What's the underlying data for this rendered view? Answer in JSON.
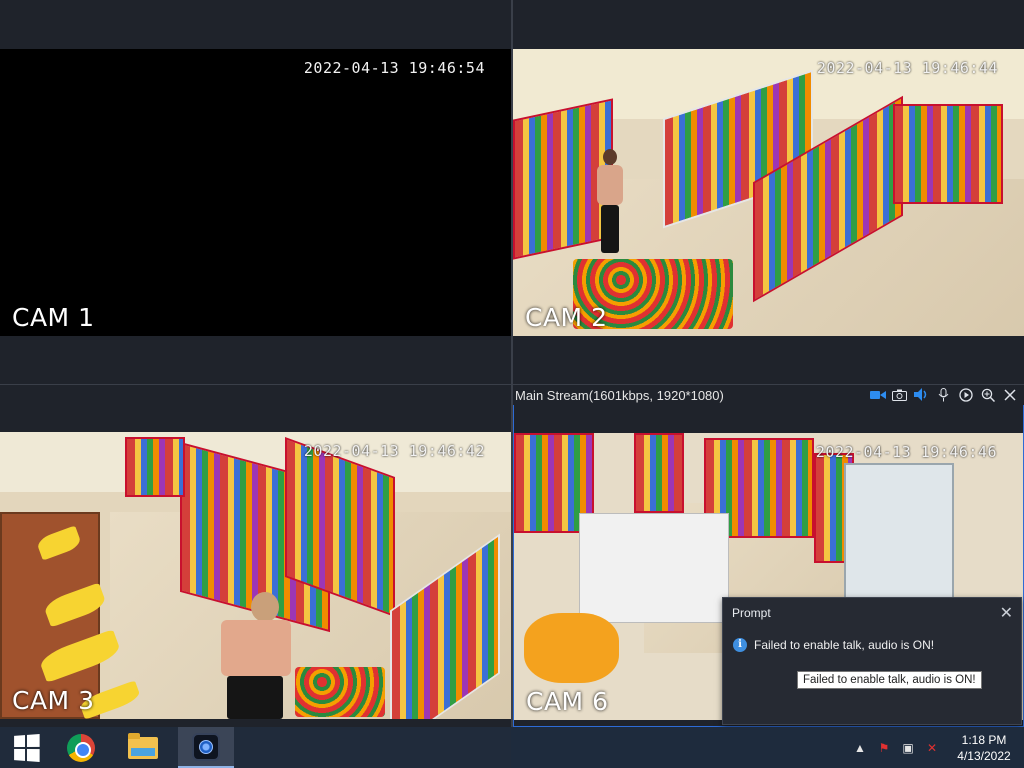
{
  "cameras": [
    {
      "label": "CAM 1",
      "timestamp": "2022-04-13 19:46:54"
    },
    {
      "label": "CAM 2",
      "timestamp": "2022-04-13 19:46:44"
    },
    {
      "label": "CAM 3",
      "timestamp": "2022-04-13 19:46:42"
    },
    {
      "label": "CAM 6",
      "timestamp": "2022-04-13 19:46:46"
    }
  ],
  "stream_bar": {
    "text": "Main Stream(1601kbps, 1920*1080)",
    "icons": [
      "record-icon",
      "snapshot-icon",
      "speaker-icon",
      "microphone-icon",
      "play-icon",
      "zoom-icon",
      "close-icon"
    ]
  },
  "prompt": {
    "title": "Prompt",
    "message": "Failed to enable talk, audio is ON!",
    "tooltip": "Failed to enable talk, audio is ON!",
    "close_glyph": "✕"
  },
  "taskbar": {
    "apps": [
      "start-button",
      "chrome",
      "file-explorer",
      "camera-client"
    ],
    "tray": {
      "time": "1:18 PM",
      "date": "4/13/2022"
    }
  }
}
